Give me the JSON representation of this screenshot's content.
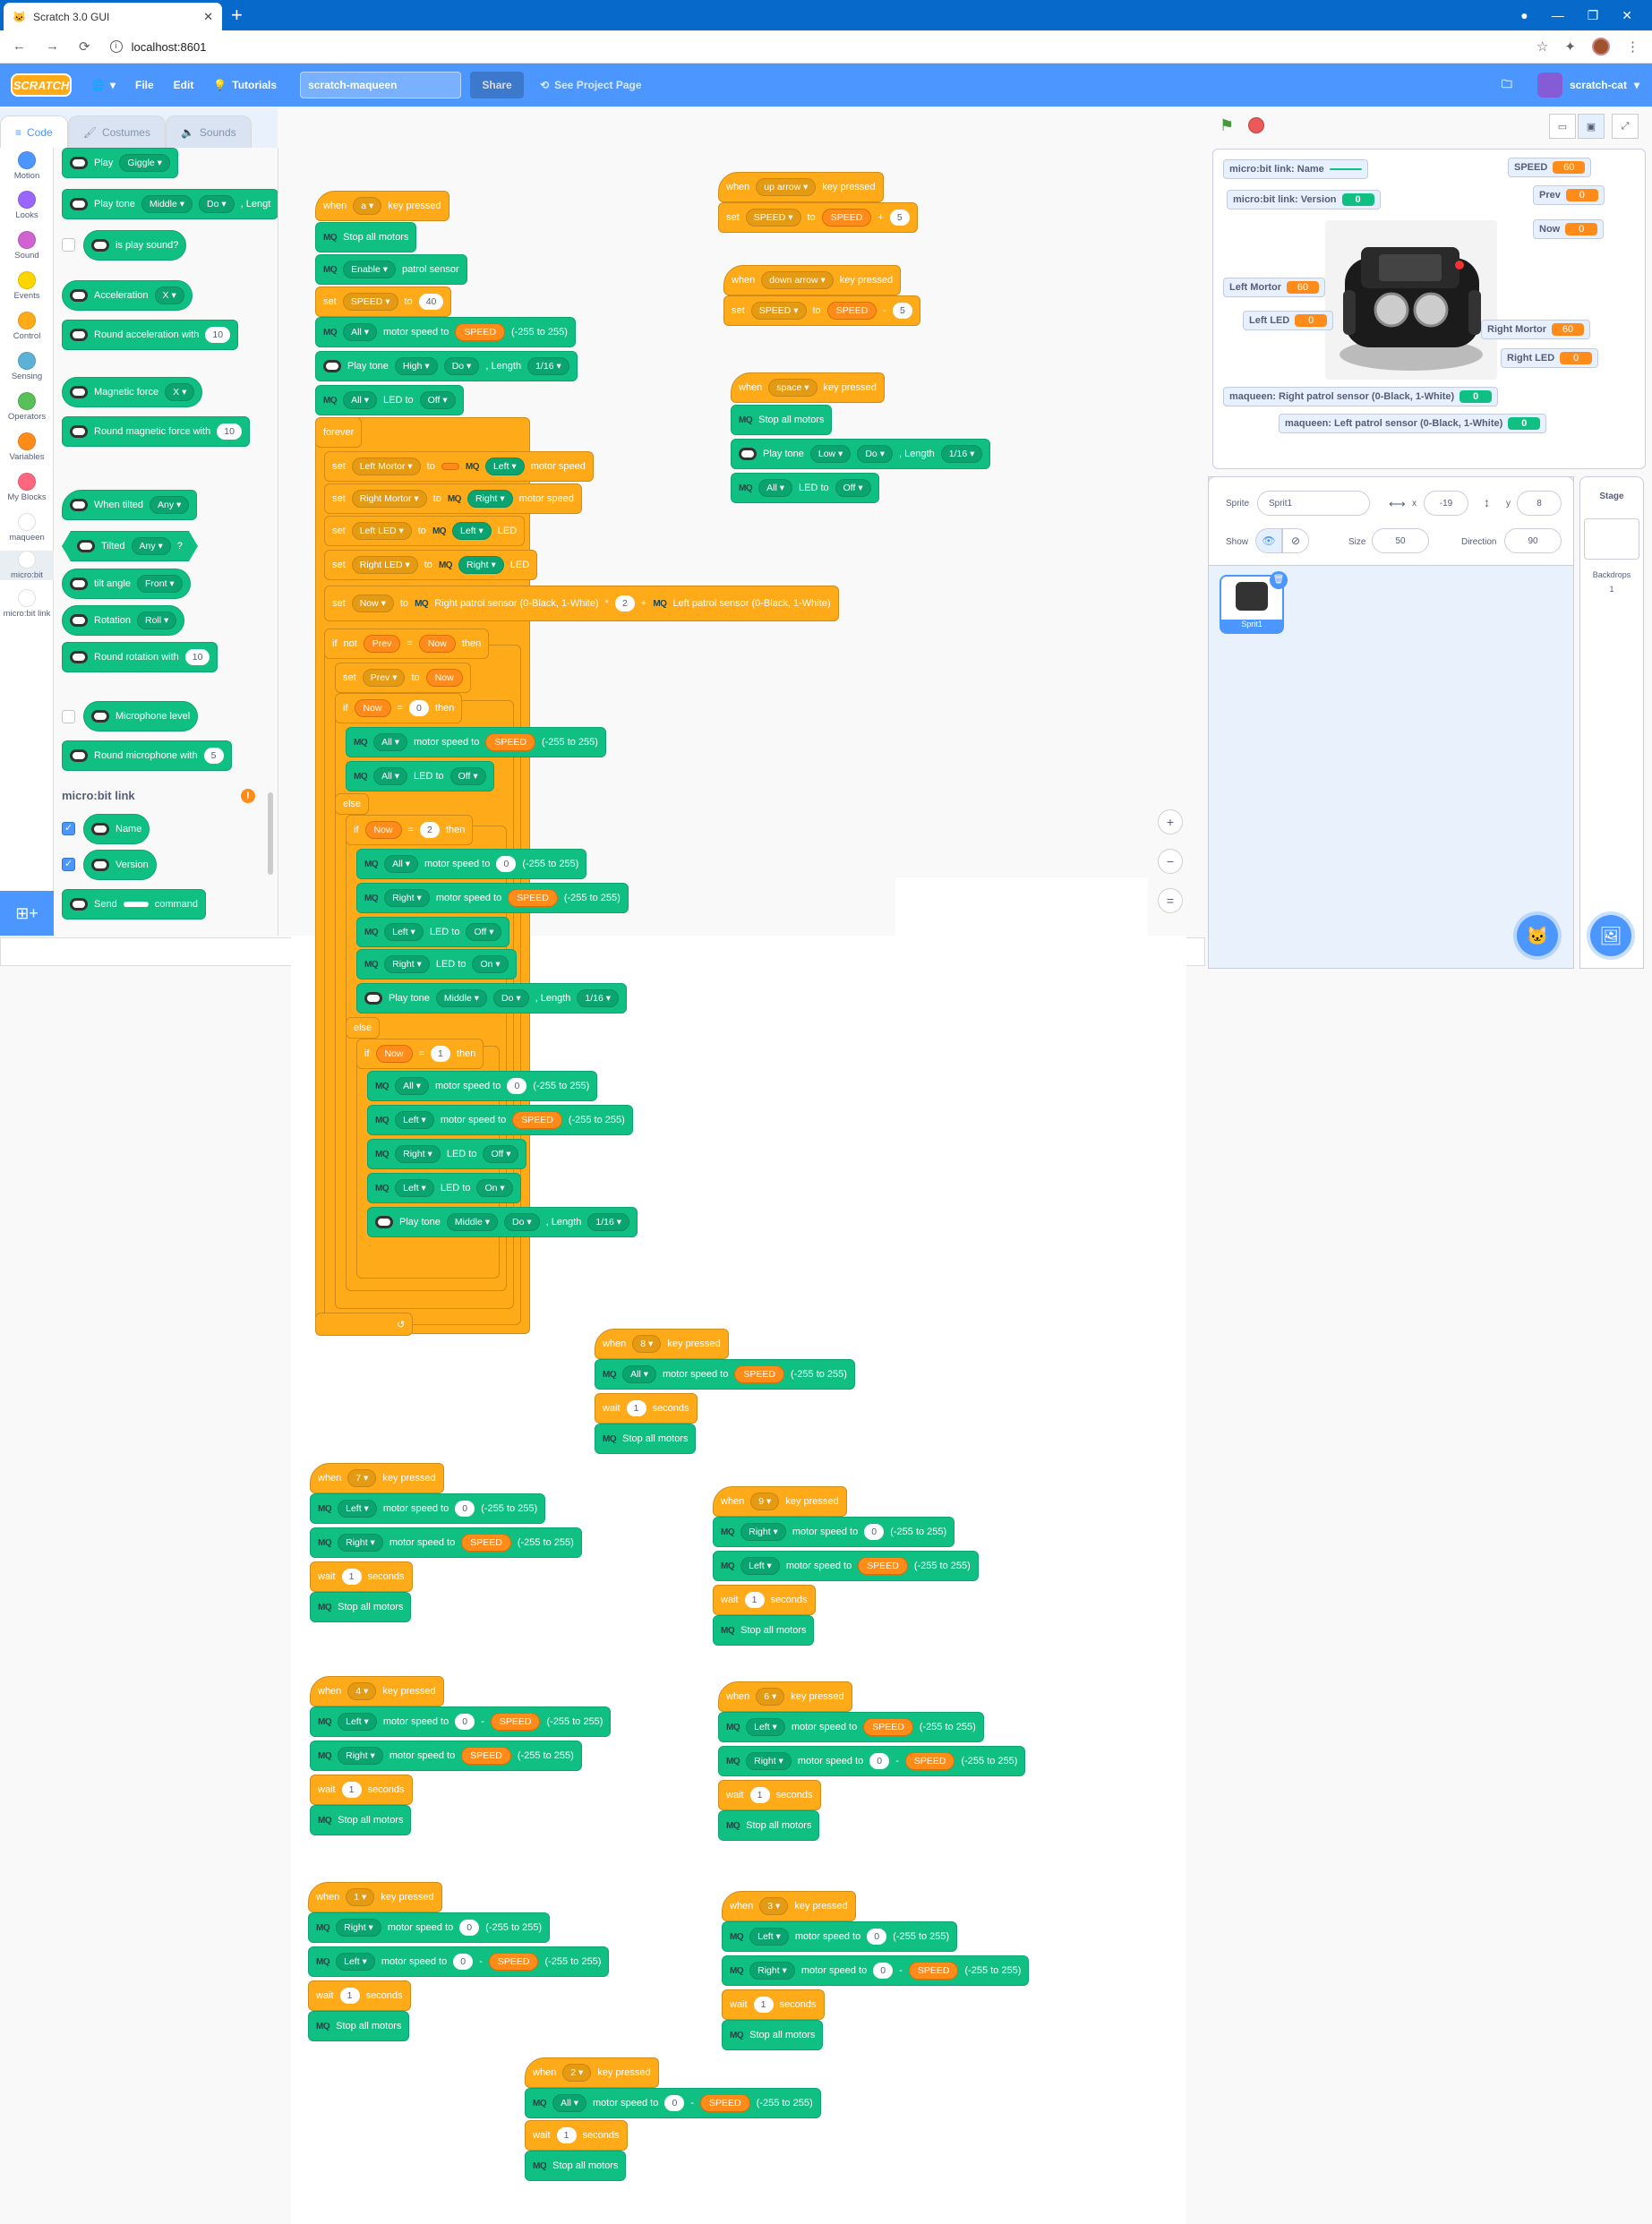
{
  "browser": {
    "tab_title": "Scratch 3.0 GUI",
    "url": "localhost:8601",
    "new_tab": "+",
    "close": "✕"
  },
  "menubar": {
    "logo": "SCRATCH",
    "file": "File",
    "edit": "Edit",
    "tutorials": "Tutorials",
    "project_name": "scratch-maqueen",
    "share": "Share",
    "see_project": "See Project Page",
    "user": "scratch-cat"
  },
  "tabs": {
    "code": "Code",
    "costumes": "Costumes",
    "sounds": "Sounds"
  },
  "categories": [
    {
      "label": "Motion",
      "color": "#4c97ff"
    },
    {
      "label": "Looks",
      "color": "#9966ff"
    },
    {
      "label": "Sound",
      "color": "#cf63cf"
    },
    {
      "label": "Events",
      "color": "#ffd500"
    },
    {
      "label": "Control",
      "color": "#ffab19"
    },
    {
      "label": "Sensing",
      "color": "#5cb1d6"
    },
    {
      "label": "Operators",
      "color": "#59c059"
    },
    {
      "label": "Variables",
      "color": "#ff8c1a"
    },
    {
      "label": "My Blocks",
      "color": "#ff6680"
    },
    {
      "label": "maqueen",
      "color": "#ffffff"
    },
    {
      "label": "micro:bit",
      "color": "#ffffff"
    },
    {
      "label": "micro:bit link",
      "color": "#ffffff"
    }
  ],
  "palette": {
    "play": "Play",
    "giggle": "Giggle",
    "play_tone": "Play tone",
    "middle": "Middle",
    "do": "Do",
    "length_cut": ", Lengt",
    "is_play_sound": "is play sound?",
    "acceleration": "Acceleration",
    "x": "X",
    "round_accel": "Round acceleration with",
    "ten": "10",
    "magnetic": "Magnetic force",
    "round_mag": "Round magnetic force with",
    "when_tilted": "When tilted",
    "any": "Any",
    "tilted": "Tilted",
    "q": "?",
    "tilt_angle": "tilt angle",
    "front": "Front",
    "rotation": "Rotation",
    "roll": "Roll",
    "round_rot": "Round rotation with",
    "mic": "Microphone level",
    "round_mic": "Round microphone with",
    "five": "5",
    "link_section": "micro:bit link",
    "warn": "!",
    "name": "Name",
    "version": "Version",
    "send": "Send",
    "command": "command",
    "check": "✓"
  },
  "words": {
    "when": "when",
    "key_pressed": "key pressed",
    "set": "set",
    "to": "to",
    "stop_all": "Stop all motors",
    "enable": "Enable",
    "patrol": "patrol sensor",
    "all": "All",
    "motor_speed_to": "motor speed to",
    "range": "(-255 to 255)",
    "play_tone": "Play tone",
    "length": ", Length",
    "led_to": "LED to",
    "off": "Off",
    "on": "On",
    "forever": "forever",
    "if": "if",
    "then": "then",
    "else": "else",
    "not": "not",
    "eq": "=",
    "plus": "+",
    "minus": "-",
    "times": "*",
    "wait": "wait",
    "seconds": "seconds",
    "left": "Left",
    "right": "Right",
    "motor_speed": "motor speed",
    "led": "LED",
    "high": "High",
    "low": "Low",
    "middle": "Middle",
    "do": "Do",
    "sixteenth": "1/16",
    "rsensor": "Right patrol sensor (0-Black, 1-White)",
    "lsensor": "Left patrol sensor (0-Black, 1-White)",
    "mq": "MQ",
    "loop": "↺"
  },
  "vars": {
    "speed": "SPEED",
    "prev": "Prev",
    "now": "Now",
    "left_mortor": "Left Mortor",
    "right_mortor": "Right Mortor",
    "left_led": "Left LED",
    "right_led": "Right LED"
  },
  "keys": {
    "a": "a",
    "up": "up arrow",
    "down": "down arrow",
    "space": "space",
    "k8": "8",
    "k7": "7",
    "k9": "9",
    "k4": "4",
    "k6": "6",
    "k1": "1",
    "k3": "3",
    "k2": "2"
  },
  "nums": {
    "n40": "40",
    "n5": "5",
    "n2": "2",
    "n0": "0",
    "n1": "1"
  },
  "monitors": {
    "link_name": "micro:bit link: Name",
    "link_version": "micro:bit link: Version",
    "link_version_val": "0",
    "speed": "SPEED",
    "speed_val": "60",
    "prev": "Prev",
    "prev_val": "0",
    "now": "Now",
    "now_val": "0",
    "left_mortor": "Left Mortor",
    "left_mortor_val": "60",
    "left_led": "Left LED",
    "left_led_val": "0",
    "right_mortor": "Right Mortor",
    "right_mortor_val": "60",
    "right_led": "Right LED",
    "right_led_val": "0",
    "rpatrol": "maqueen: Right patrol sensor (0-Black, 1-White)",
    "rpatrol_val": "0",
    "lpatrol": "maqueen: Left patrol sensor (0-Black, 1-White)",
    "lpatrol_val": "0"
  },
  "sprite": {
    "label": "Sprite",
    "name": "Sprit1",
    "x_label": "x",
    "x": "-19",
    "y_label": "y",
    "y": "8",
    "show": "Show",
    "size_label": "Size",
    "size": "50",
    "dir_label": "Direction",
    "dir": "90",
    "thumb_name": "Sprit1"
  },
  "stage": {
    "label": "Stage",
    "backdrops": "Backdrops",
    "count": "1"
  },
  "zoom": {
    "in": "+",
    "out": "−",
    "reset": "="
  }
}
